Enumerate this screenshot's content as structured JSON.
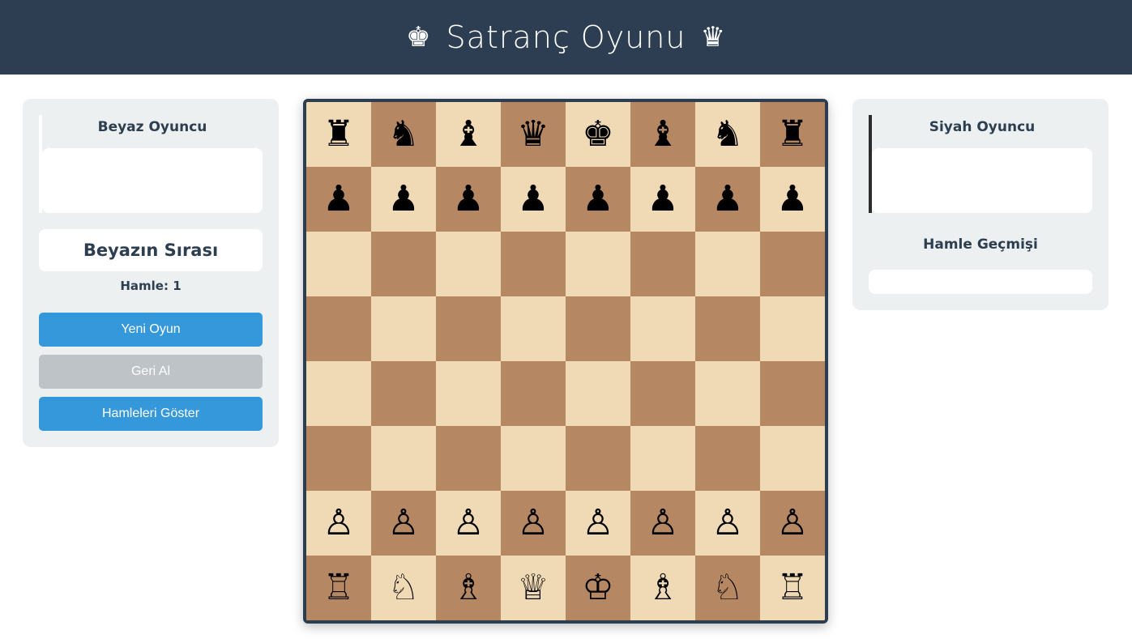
{
  "header": {
    "title": "Satranç Oyunu",
    "icon_left": "♚",
    "icon_right": "♛"
  },
  "white_player": {
    "title": "Beyaz Oyuncu"
  },
  "black_player": {
    "title": "Siyah Oyuncu"
  },
  "turn": {
    "text": "Beyazın Sırası"
  },
  "move_count": {
    "text": "Hamle: 1"
  },
  "buttons": {
    "new_game": "Yeni Oyun",
    "undo": "Geri Al",
    "show_moves": "Hamleleri Göster"
  },
  "history": {
    "title": "Hamle Geçmişi"
  },
  "colors": {
    "header": "#2e3e52",
    "light_square": "#f0d9b5",
    "dark_square": "#b58863",
    "primary_button": "#3498db",
    "disabled_button": "#bdc3c7"
  },
  "board": {
    "rows": [
      [
        "♜",
        "♞",
        "♝",
        "♛",
        "♚",
        "♝",
        "♞",
        "♜"
      ],
      [
        "♟",
        "♟",
        "♟",
        "♟",
        "♟",
        "♟",
        "♟",
        "♟"
      ],
      [
        "",
        "",
        "",
        "",
        "",
        "",
        "",
        ""
      ],
      [
        "",
        "",
        "",
        "",
        "",
        "",
        "",
        ""
      ],
      [
        "",
        "",
        "",
        "",
        "",
        "",
        "",
        ""
      ],
      [
        "",
        "",
        "",
        "",
        "",
        "",
        "",
        ""
      ],
      [
        "♙",
        "♙",
        "♙",
        "♙",
        "♙",
        "♙",
        "♙",
        "♙"
      ],
      [
        "♖",
        "♘",
        "♗",
        "♕",
        "♔",
        "♗",
        "♘",
        "♖"
      ]
    ]
  }
}
